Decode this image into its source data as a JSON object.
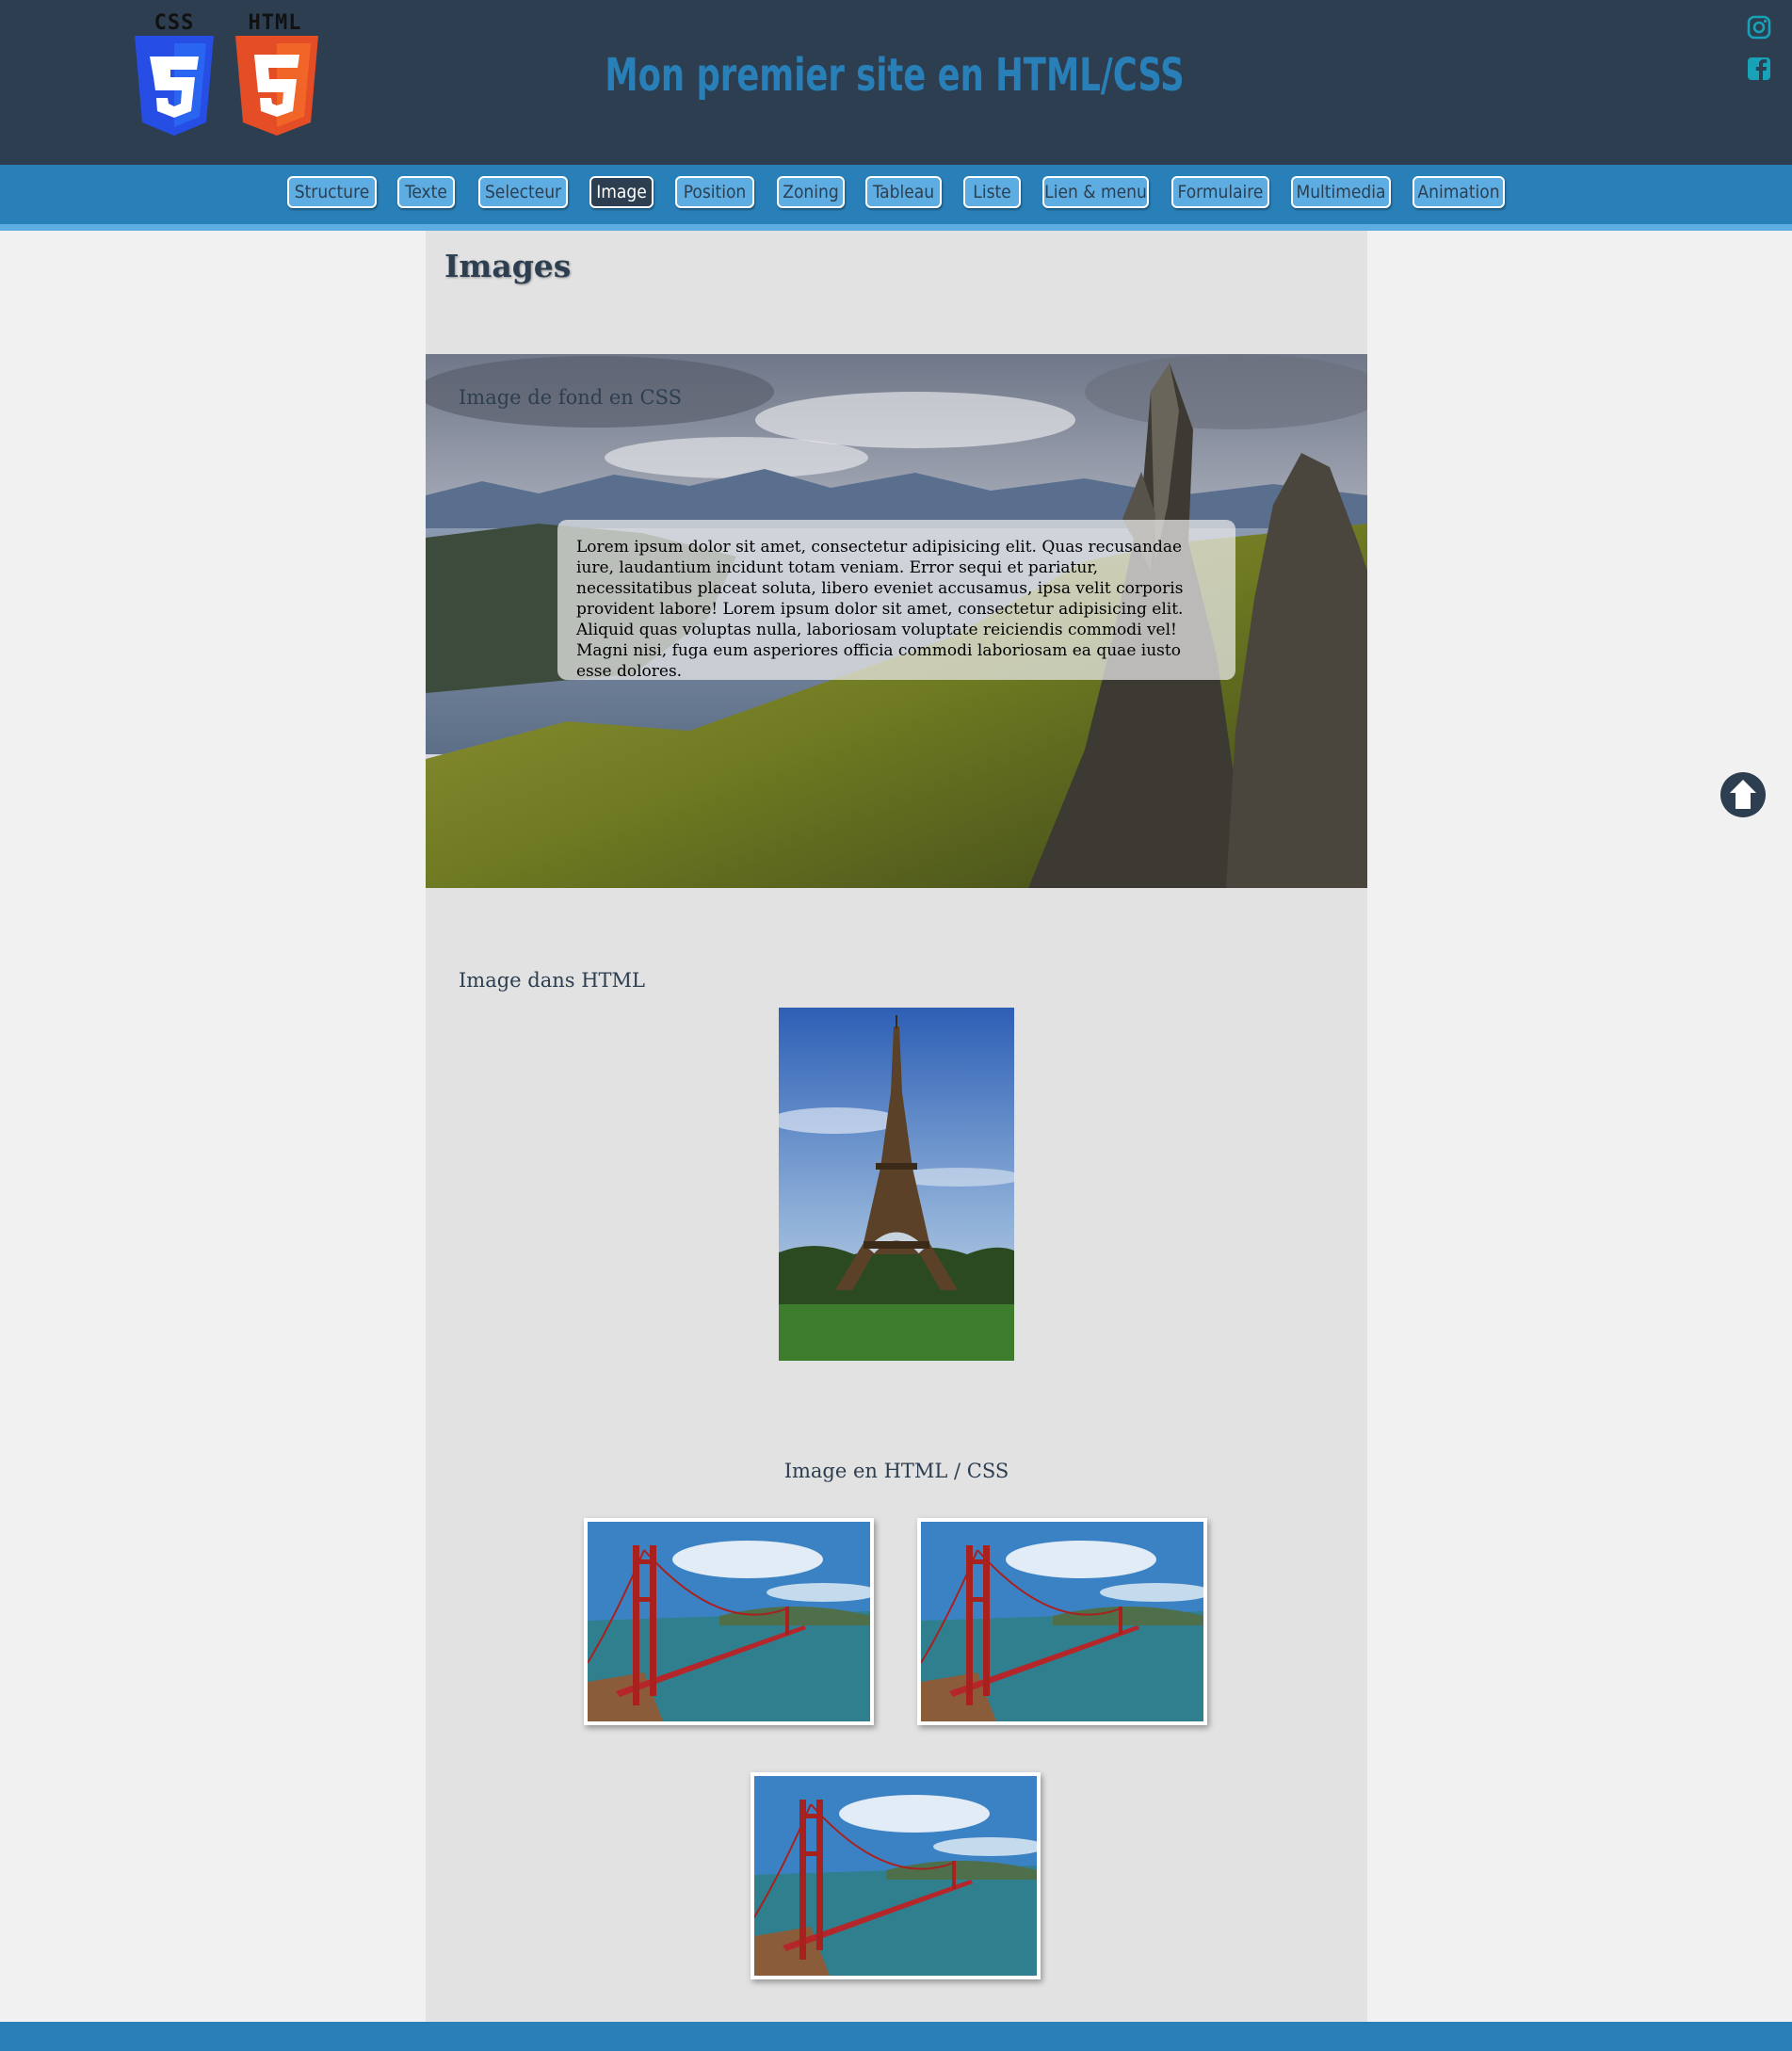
{
  "header": {
    "logos": [
      {
        "label": "CSS",
        "icon": "css3-shield-icon",
        "color": "#2965f1"
      },
      {
        "label": "HTML",
        "icon": "html5-shield-icon",
        "color": "#e44d26"
      }
    ],
    "title": "Mon premier site en HTML/CSS",
    "title_color": "#2980b9",
    "social": [
      "instagram-icon",
      "facebook-icon"
    ]
  },
  "nav": {
    "items": [
      {
        "label": "Structure"
      },
      {
        "label": "Texte"
      },
      {
        "label": "Selecteur"
      },
      {
        "label": "Image",
        "active": true
      },
      {
        "label": "Position"
      },
      {
        "label": "Zoning"
      },
      {
        "label": "Tableau"
      },
      {
        "label": "Liste"
      },
      {
        "label": "Lien & menu"
      },
      {
        "label": "Formulaire"
      },
      {
        "label": "Multimedia"
      },
      {
        "label": "Animation"
      }
    ]
  },
  "main": {
    "title": "Images",
    "background_section": {
      "caption": "Image de fond en CSS",
      "text": "Lorem ipsum dolor sit amet, consectetur adipisicing elit. Quas recusandae iure, laudantium incidunt totam veniam. Error sequi et pariatur, necessitatibus placeat soluta, libero eveniet accusamus, ipsa velit corporis provident labore! Lorem ipsum dolor sit amet, consectetur adipisicing elit. Aliquid quas voluptas nulla, laboriosam voluptate reiciendis commodi vel! Magni nisi, fuga eum asperiores officia commodi laboriosam ea quae iusto esse dolores."
    },
    "html_image_section": {
      "caption": "Image dans HTML",
      "image": "eiffel-tower-photo"
    },
    "html_css_section": {
      "caption": "Image en HTML / CSS",
      "images": [
        "golden-gate-photo",
        "golden-gate-photo",
        "golden-gate-photo"
      ]
    }
  },
  "colors": {
    "header_bg": "#2c3e50",
    "nav_bg": "#2980b9",
    "nav_button": "#5dade2",
    "content_bg": "#e2e2e2",
    "page_bg": "#f1f1f1"
  },
  "back_to_top": "arrow-up-circle-icon"
}
